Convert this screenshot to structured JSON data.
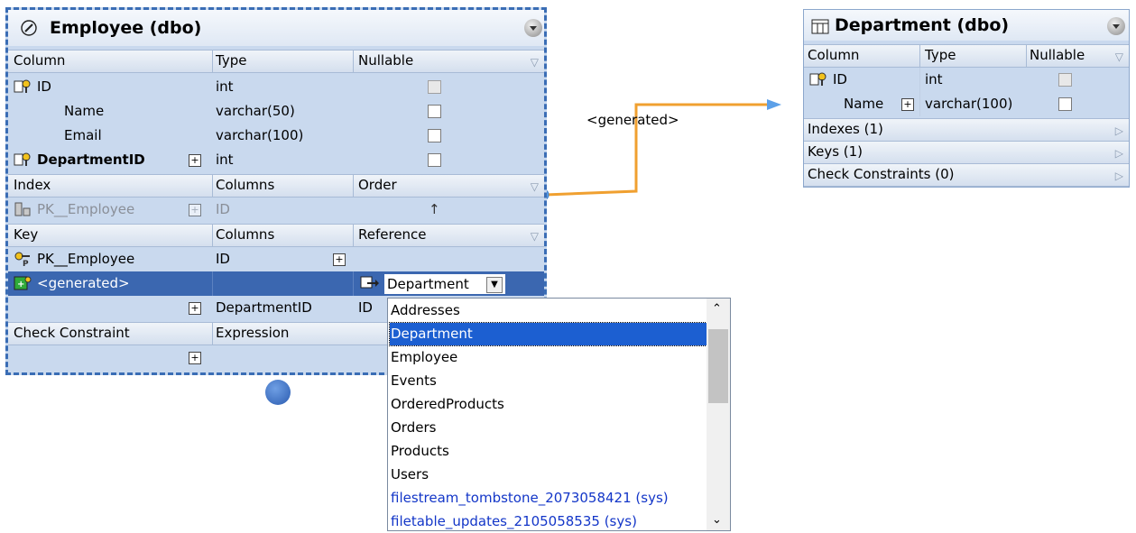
{
  "connector": {
    "label": "<generated>",
    "color": "#f0a030"
  },
  "employee": {
    "title": "Employee (dbo)",
    "columns_header": {
      "c1": "Column",
      "c2": "Type",
      "c3": "Nullable"
    },
    "columns": [
      {
        "name": "ID",
        "type": "int",
        "nullable": false,
        "pk": true
      },
      {
        "name": "Name",
        "type": "varchar(50)",
        "nullable": false
      },
      {
        "name": "Email",
        "type": "varchar(100)",
        "nullable": false
      },
      {
        "name": "DepartmentID",
        "type": "int",
        "nullable": false,
        "fk": true
      }
    ],
    "index_header": {
      "c1": "Index",
      "c2": "Columns",
      "c3": "Order"
    },
    "index": {
      "name": "PK__Employee",
      "columns": "ID",
      "order": "↑"
    },
    "key_header": {
      "c1": "Key",
      "c2": "Columns",
      "c3": "Reference"
    },
    "keys": [
      {
        "name": "PK__Employee",
        "columns": "ID"
      },
      {
        "name": "<generated>",
        "reference": "Department"
      }
    ],
    "key_sub": {
      "columns": "DepartmentID",
      "ref_col": "ID"
    },
    "check_header": {
      "c1": "Check Constraint",
      "c2": "Expression"
    }
  },
  "department": {
    "title": "Department (dbo)",
    "columns_header": {
      "c1": "Column",
      "c2": "Type",
      "c3": "Nullable"
    },
    "columns": [
      {
        "name": "ID",
        "type": "int",
        "pk": true
      },
      {
        "name": "Name",
        "type": "varchar(100)"
      }
    ],
    "sections": [
      "Indexes (1)",
      "Keys (1)",
      "Check Constraints (0)"
    ]
  },
  "dropdown": {
    "selected": "Department",
    "options": [
      "Addresses",
      "Department",
      "Employee",
      "Events",
      "OrderedProducts",
      "Orders",
      "Products",
      "Users",
      "filestream_tombstone_2073058421 (sys)",
      "filetable_updates_2105058535 (sys)"
    ],
    "scroll_position": 0.35
  }
}
